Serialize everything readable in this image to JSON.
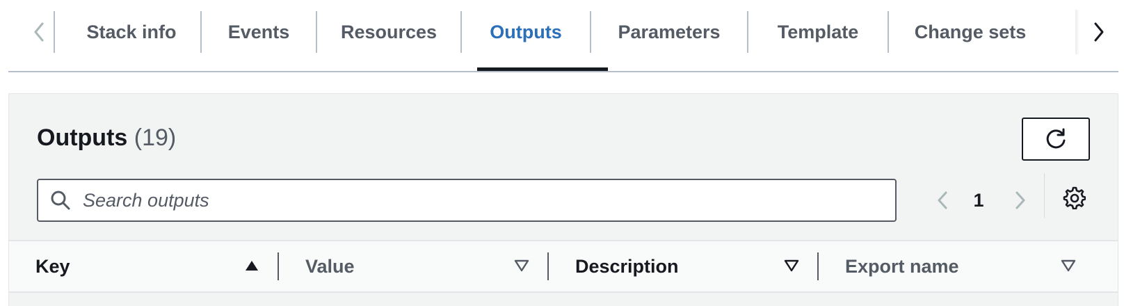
{
  "tabs": {
    "items": [
      {
        "label": "Stack info"
      },
      {
        "label": "Events"
      },
      {
        "label": "Resources"
      },
      {
        "label": "Outputs",
        "active": true
      },
      {
        "label": "Parameters"
      },
      {
        "label": "Template"
      },
      {
        "label": "Change sets"
      }
    ],
    "active_color": "#2a6fb8"
  },
  "panel": {
    "title": "Outputs",
    "count": "(19)",
    "search": {
      "placeholder": "Search outputs",
      "value": ""
    },
    "pagination": {
      "current_page": "1"
    }
  },
  "table": {
    "columns": [
      {
        "label": "Key",
        "sort": "ascending"
      },
      {
        "label": "Value",
        "sort": "none"
      },
      {
        "label": "Description",
        "sort": "none"
      },
      {
        "label": "Export name",
        "sort": "none"
      }
    ]
  },
  "icons": {
    "tabs_prev": "chevron-left-icon",
    "tabs_next": "chevron-right-icon",
    "refresh": "refresh-icon",
    "search": "search-icon",
    "page_prev": "chevron-left-icon",
    "page_next": "chevron-right-icon",
    "settings": "gear-icon",
    "sort_asc": "caret-up-filled-icon",
    "sort_none": "caret-down-outline-icon"
  }
}
